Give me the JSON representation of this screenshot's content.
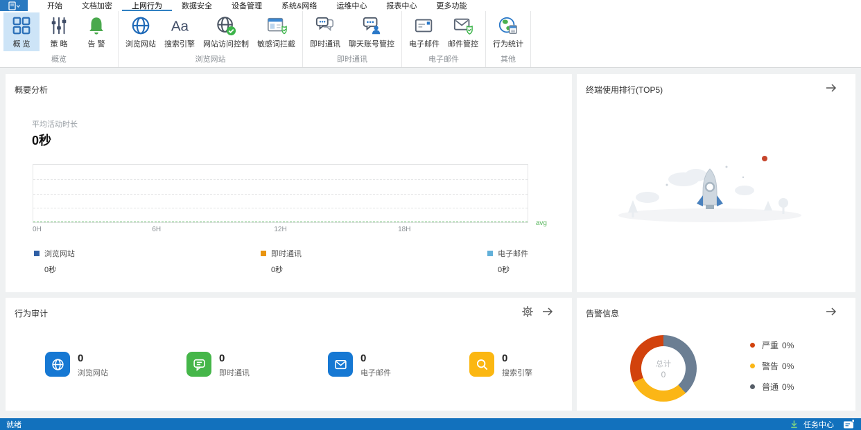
{
  "tabbar": {
    "active": "上网行为",
    "tabs": [
      {
        "label": "开始"
      },
      {
        "label": "文档加密"
      },
      {
        "label": "上网行为"
      },
      {
        "label": "数据安全"
      },
      {
        "label": "设备管理"
      },
      {
        "label": "系统&网络"
      },
      {
        "label": "运维中心"
      },
      {
        "label": "报表中心"
      },
      {
        "label": "更多功能"
      }
    ]
  },
  "ribbon": {
    "groups": [
      {
        "label": "概览",
        "buttons": [
          {
            "label": "概 览",
            "icon": "grid-icon",
            "selected": true
          },
          {
            "label": "策 略",
            "icon": "sliders-icon",
            "selected": false
          },
          {
            "label": "告 警",
            "icon": "bell-icon",
            "selected": false
          }
        ]
      },
      {
        "label": "浏览网站",
        "buttons": [
          {
            "label": "浏览网站",
            "icon": "globe-icon",
            "selected": false
          },
          {
            "label": "搜索引擎",
            "icon": "font-icon",
            "selected": false
          },
          {
            "label": "网站访问控制",
            "icon": "globe-check-icon",
            "selected": false
          },
          {
            "label": "敏感词拦截",
            "icon": "window-shield-icon",
            "selected": false
          }
        ]
      },
      {
        "label": "即时通讯",
        "buttons": [
          {
            "label": "即时通讯",
            "icon": "chat-icon",
            "selected": false
          },
          {
            "label": "聊天账号管控",
            "icon": "chat-user-icon",
            "selected": false
          }
        ]
      },
      {
        "label": "电子邮件",
        "buttons": [
          {
            "label": "电子邮件",
            "icon": "mail-icon",
            "selected": false
          },
          {
            "label": "邮件管控",
            "icon": "mail-shield-icon",
            "selected": false
          }
        ]
      },
      {
        "label": "其他",
        "buttons": [
          {
            "label": "行为统计",
            "icon": "globe-stats-icon",
            "selected": false
          }
        ]
      }
    ]
  },
  "summary": {
    "title": "概要分析",
    "metric_label": "平均活动时长",
    "metric_value": "0秒",
    "avg_label": "avg",
    "x_ticks": [
      "0H",
      "6H",
      "12H",
      "18H"
    ],
    "legend": [
      {
        "name": "浏览网站",
        "value": "0秒",
        "color": "#2f5fa5"
      },
      {
        "name": "即时通讯",
        "value": "0秒",
        "color": "#e9940f"
      },
      {
        "name": "电子邮件",
        "value": "0秒",
        "color": "#62b0d9"
      }
    ]
  },
  "ranking": {
    "title": "终端使用排行(TOP5)"
  },
  "audit": {
    "title": "行为审计",
    "stats": [
      {
        "value": "0",
        "label": "浏览网站",
        "icon": "globe-icon",
        "color": "#1678d3"
      },
      {
        "value": "0",
        "label": "即时通讯",
        "icon": "chat-icon",
        "color": "#45b649"
      },
      {
        "value": "0",
        "label": "电子邮件",
        "icon": "mail-icon",
        "color": "#1678d3"
      },
      {
        "value": "0",
        "label": "搜索引擎",
        "icon": "search-icon",
        "color": "#fbb712"
      }
    ]
  },
  "alerts": {
    "title": "告警信息",
    "center_label": "总计",
    "center_value": "0",
    "segments": [
      {
        "name": "严重",
        "percent_label": "0%",
        "color": "#d2420d",
        "dot_color": "#d2420d",
        "start_deg": 245,
        "end_deg": 360
      },
      {
        "name": "警告",
        "percent_label": "0%",
        "color": "#fbb616",
        "dot_color": "#fbb616",
        "start_deg": 138,
        "end_deg": 245
      },
      {
        "name": "普通",
        "percent_label": "0%",
        "color": "#6b7e93",
        "dot_color": "#565e68",
        "start_deg": 0,
        "end_deg": 138
      }
    ]
  },
  "statusbar": {
    "left_text": "就绪",
    "task_center_label": "任务中心"
  },
  "chart_data": [
    {
      "type": "line",
      "title": "平均活动时长",
      "xlabel": "",
      "ylabel": "",
      "x_ticks": [
        "0H",
        "6H",
        "12H",
        "18H"
      ],
      "x_range_hours": [
        0,
        24
      ],
      "grid": true,
      "avg_line": {
        "label": "avg",
        "value": "0秒"
      },
      "series": [
        {
          "name": "浏览网站",
          "total": "0秒",
          "values": []
        },
        {
          "name": "即时通讯",
          "total": "0秒",
          "values": []
        },
        {
          "name": "电子邮件",
          "total": "0秒",
          "values": []
        }
      ],
      "note": "no data recorded, all series empty / 0"
    },
    {
      "type": "pie",
      "title": "告警信息",
      "center_label": "总计",
      "center_value": "0",
      "legend_position": "right",
      "slices": [
        {
          "name": "严重",
          "label_percent": "0%",
          "visual_sweep_deg": 115
        },
        {
          "name": "警告",
          "label_percent": "0%",
          "visual_sweep_deg": 107
        },
        {
          "name": "普通",
          "label_percent": "0%",
          "visual_sweep_deg": 138
        }
      ]
    }
  ]
}
